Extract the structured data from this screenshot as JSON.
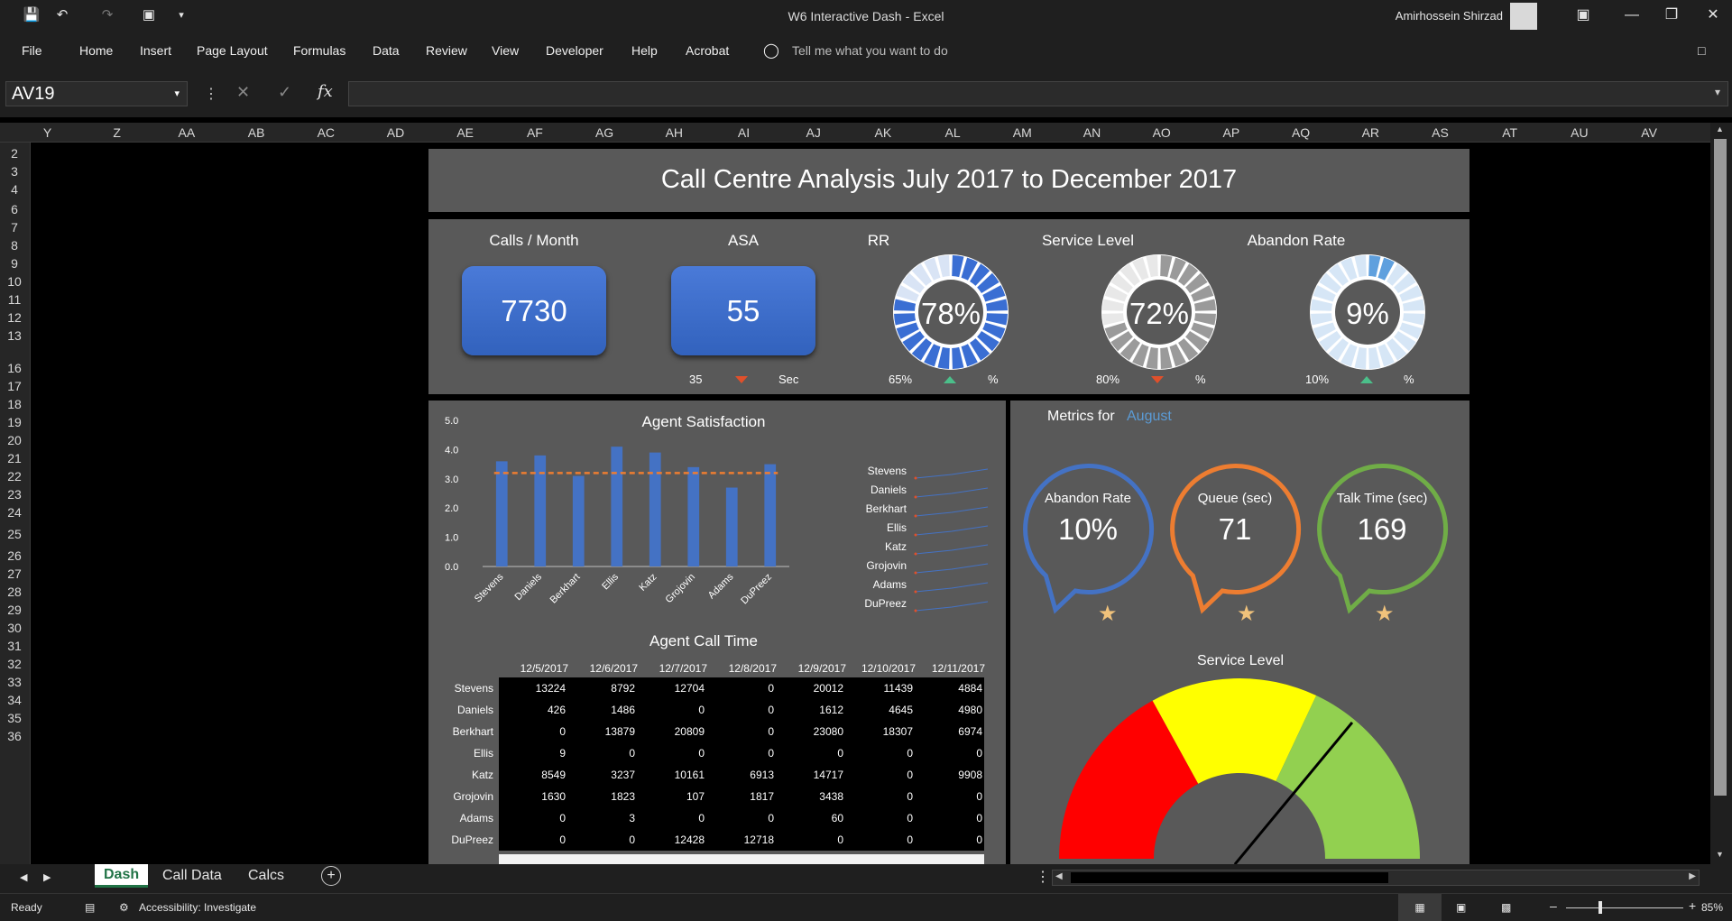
{
  "window": {
    "title": "W6 Interactive Dash",
    "app": "Excel",
    "user": "Amirhossein Shirzad"
  },
  "ribbon_tabs": [
    "File",
    "Home",
    "Insert",
    "Page Layout",
    "Formulas",
    "Data",
    "Review",
    "View",
    "Developer",
    "Help",
    "Acrobat"
  ],
  "tell_me": "Tell me what you want to do",
  "name_box": "AV19",
  "columns": [
    "Y",
    "Z",
    "AA",
    "AB",
    "AC",
    "AD",
    "AE",
    "AF",
    "AG",
    "AH",
    "AI",
    "AJ",
    "AK",
    "AL",
    "AM",
    "AN",
    "AO",
    "AP",
    "AQ",
    "AR",
    "AS",
    "AT",
    "AU",
    "AV"
  ],
  "rows": [
    "2",
    "3",
    "4",
    "6",
    "7",
    "8",
    "9",
    "10",
    "11",
    "12",
    "13",
    "16",
    "17",
    "18",
    "19",
    "20",
    "21",
    "22",
    "23",
    "24",
    "25",
    "26",
    "27",
    "28",
    "29",
    "30",
    "31",
    "32",
    "33",
    "34",
    "35",
    "36"
  ],
  "dashboard": {
    "title": "Call Centre Analysis July 2017 to December 2017",
    "kpis": [
      {
        "label": "Calls / Month",
        "value": "7730"
      },
      {
        "label": "ASA",
        "value": "55",
        "target": "35",
        "unit": "Sec",
        "trend": "down"
      },
      {
        "label": "RR",
        "value": "78%",
        "target": "65%",
        "unit": "%",
        "trend": "up",
        "fraction": 0.78
      },
      {
        "label": "Service Level",
        "value": "72%",
        "target": "80%",
        "unit": "%",
        "trend": "down",
        "fraction": 0.72
      },
      {
        "label": "Abandon Rate",
        "value": "9%",
        "target": "10%",
        "unit": "%",
        "trend": "up",
        "fraction": 0.09
      }
    ],
    "metrics": {
      "label": "Metrics for",
      "month": "August",
      "items": [
        {
          "label": "Abandon Rate",
          "value": "10%",
          "color": "#4472c4"
        },
        {
          "label": "Queue  (sec)",
          "value": "71",
          "color": "#ed7d31"
        },
        {
          "label": "Talk Time (sec)",
          "value": "169",
          "color": "#70ad47"
        }
      ],
      "star": "★"
    },
    "gauge_title": "Service Level",
    "gauge_value": 0.72,
    "call_time": {
      "title": "Agent Call Time",
      "dates": [
        "12/5/2017",
        "12/6/2017",
        "12/7/2017",
        "12/8/2017",
        "12/9/2017",
        "12/10/2017",
        "12/11/2017"
      ],
      "rows": [
        {
          "name": "Stevens",
          "values": [
            "13224",
            "8792",
            "12704",
            "0",
            "20012",
            "11439",
            "4884"
          ]
        },
        {
          "name": "Daniels",
          "values": [
            "426",
            "1486",
            "0",
            "0",
            "1612",
            "4645",
            "4980"
          ]
        },
        {
          "name": "Berkhart",
          "values": [
            "0",
            "13879",
            "20809",
            "0",
            "23080",
            "18307",
            "6974"
          ]
        },
        {
          "name": "Ellis",
          "values": [
            "9",
            "0",
            "0",
            "0",
            "0",
            "0",
            "0"
          ]
        },
        {
          "name": "Katz",
          "values": [
            "8549",
            "3237",
            "10161",
            "6913",
            "14717",
            "0",
            "9908"
          ]
        },
        {
          "name": "Grojovin",
          "values": [
            "1630",
            "1823",
            "107",
            "1817",
            "3438",
            "0",
            "0"
          ]
        },
        {
          "name": "Adams",
          "values": [
            "0",
            "3",
            "0",
            "0",
            "60",
            "0",
            "0"
          ]
        },
        {
          "name": "DuPreez",
          "values": [
            "0",
            "0",
            "12428",
            "12718",
            "0",
            "0",
            "0"
          ]
        }
      ]
    }
  },
  "chart_data": {
    "type": "bar",
    "title": "Agent Satisfaction",
    "categories": [
      "Stevens",
      "Daniels",
      "Berkhart",
      "Ellis",
      "Katz",
      "Grojovin",
      "Adams",
      "DuPreez"
    ],
    "values": [
      3.6,
      3.8,
      3.1,
      4.1,
      3.9,
      3.4,
      2.7,
      3.5
    ],
    "average": 3.2,
    "ylim": [
      0,
      5
    ],
    "yticks": [
      "0.0",
      "1.0",
      "2.0",
      "3.0",
      "4.0",
      "5.0"
    ],
    "bar_color": "#4472c4",
    "avg_color": "#ed7d31"
  },
  "sheet_tabs": [
    "Dash",
    "Call Data",
    "Calcs"
  ],
  "status": {
    "ready": "Ready",
    "accessibility": "Accessibility: Investigate",
    "zoom": "85%"
  }
}
